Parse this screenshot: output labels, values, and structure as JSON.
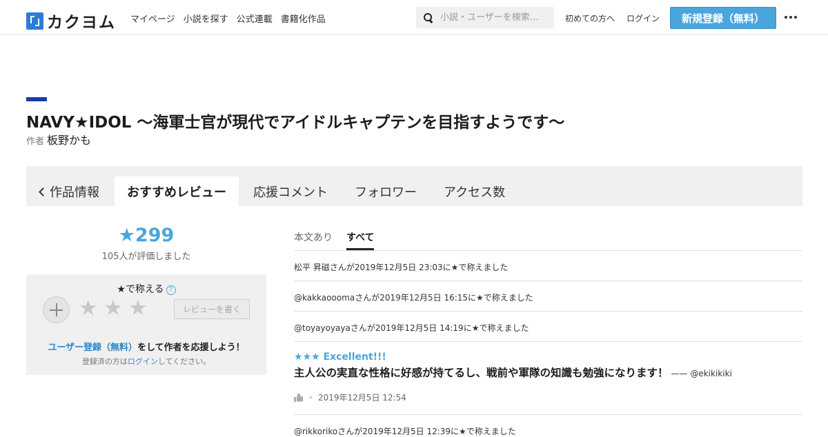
{
  "header": {
    "logo_text": "カクヨム",
    "nav": [
      "マイページ",
      "小説を探す",
      "公式連載",
      "書籍化作品"
    ],
    "search_placeholder": "小説・ユーザーを検索…",
    "first_time": "初めての方へ",
    "login": "ログイン",
    "signup": "新規登録（無料）"
  },
  "work": {
    "title": "NAVY★IDOL ～海軍士官が現代でアイドルキャプテンを目指すようです～",
    "author_label": "作者",
    "author": "板野かも"
  },
  "tabs": {
    "info": "作品情報",
    "reviews": "おすすめレビュー",
    "comments": "応援コメント",
    "followers": "フォロワー",
    "access": "アクセス数"
  },
  "rating": {
    "score": "★299",
    "raters": "105人が評価しました",
    "praise_label": "★で称える",
    "help": "?",
    "write_review": "レビューを書く",
    "signup_link": "ユーザー登録（無料）",
    "signup_tail": "をして作者を応援しよう！",
    "registered_pre": "登録済の方は",
    "login_link": "ログイン",
    "registered_post": "してください。"
  },
  "filters": {
    "with_text": "本文あり",
    "all": "すべて"
  },
  "entries": [
    "松平 昇磁さんが2019年12月5日 23:03に★で称えました",
    "@kakkaooomaさんが2019年12月5日 16:15に★で称えました",
    "@toyayoyayaさんが2019年12月5日 14:19に★で称えました"
  ],
  "review": {
    "stars_title": "★★★ Excellent!!!",
    "body": "主人公の実直な性格に好感が持てるし、戦前や軍隊の知識も勉強になります！",
    "by": "—— @ekikikiki",
    "date": "2019年12月5日 12:54"
  },
  "last_entry": "@rikkorikoさんが2019年12月5日 12:39に★で称えました",
  "colors": {
    "accent": "#4aa5dd",
    "title_bar": "#1a3aa8",
    "link": "#2b86c5"
  }
}
